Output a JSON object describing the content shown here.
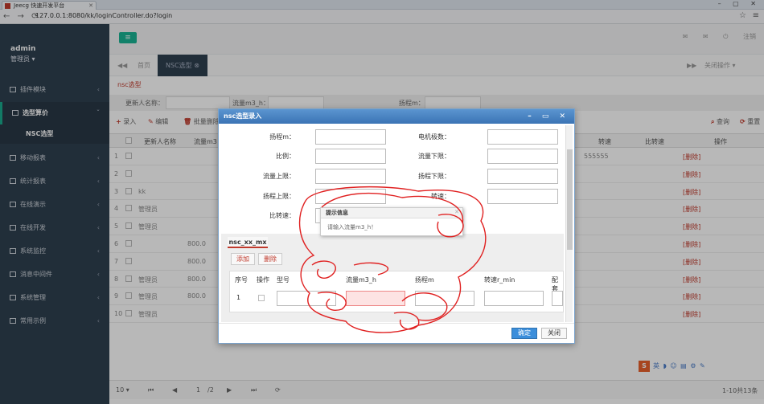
{
  "browser": {
    "tab_title": "Jeecg 快速开发平台",
    "url": "127.0.0.1:8080/kk/loginController.do?login"
  },
  "sidebar": {
    "user": "admin",
    "role": "管理员 ▾",
    "items": [
      {
        "label": "插件模块"
      },
      {
        "label": "选型算价"
      },
      {
        "label": "移动报表"
      },
      {
        "label": "统计报表"
      },
      {
        "label": "在线演示"
      },
      {
        "label": "在线开发"
      },
      {
        "label": "系统监控"
      },
      {
        "label": "消息中间件"
      },
      {
        "label": "系统管理"
      },
      {
        "label": "常用示例"
      }
    ],
    "sub_item": "NSC选型"
  },
  "header": {
    "exit_label": "注销"
  },
  "tabs": {
    "home": "首页",
    "current": "NSC选型",
    "close_ops": "关闭操作 ▾"
  },
  "main": {
    "breadcrumb": "nsc选型",
    "search": {
      "name_label": "更新人名称：",
      "flow_label": "流量m3_h：",
      "head_label": "扬程m："
    },
    "toolbar": {
      "add": "录入",
      "edit": "编辑",
      "batch_delete": "批量删除",
      "query": "查询",
      "reset": "重置"
    },
    "columns": [
      "更新人名称",
      "流量m3",
      "转速",
      "比转速",
      "操作"
    ],
    "rows": [
      {
        "no": "1",
        "name": "",
        "flow": "",
        "speed": "555555",
        "op": "[删除]"
      },
      {
        "no": "2",
        "name": "",
        "flow": "",
        "speed": "",
        "op": "[删除]"
      },
      {
        "no": "3",
        "name": "kk",
        "flow": "",
        "speed": "",
        "op": "[删除]"
      },
      {
        "no": "4",
        "name": "管理员",
        "flow": "",
        "speed": "",
        "op": "[删除]"
      },
      {
        "no": "5",
        "name": "管理员",
        "flow": "",
        "speed": "",
        "op": "[删除]"
      },
      {
        "no": "6",
        "name": "",
        "flow": "800.0",
        "speed": "",
        "op": "[删除]"
      },
      {
        "no": "7",
        "name": "",
        "flow": "800.0",
        "speed": "",
        "op": "[删除]"
      },
      {
        "no": "8",
        "name": "管理员",
        "flow": "800.0",
        "speed": "",
        "op": "[删除]"
      },
      {
        "no": "9",
        "name": "管理员",
        "flow": "800.0",
        "speed": "",
        "op": "[删除]"
      },
      {
        "no": "10",
        "name": "管理员",
        "flow": "",
        "speed": "",
        "op": "[删除]"
      }
    ],
    "pager": {
      "page_size": "10 ▾",
      "page_input": "1",
      "page_total": "/2",
      "range": "1-10共13条"
    }
  },
  "dialog": {
    "title": "nsc选型录入",
    "fields": {
      "head": "扬程m：",
      "motor_poles": "电机极数：",
      "ratio": "比例：",
      "flow_lower": "流量下限：",
      "flow_upper": "流量上限：",
      "head_lower": "扬程下限：",
      "head_upper": "扬程上限：",
      "speed": "转速：",
      "specific_speed": "比转速："
    },
    "sub_tab": "nsc_xx_mx",
    "sub_add": "添加",
    "sub_delete": "删除",
    "sub_columns": [
      "序号",
      "操作",
      "型号",
      "流量m3_h",
      "扬程m",
      "转速r_min",
      "配套功"
    ],
    "sub_row_no": "1",
    "ok": "确定",
    "close": "关闭"
  },
  "tip": {
    "title": "提示信息",
    "message": "请输入流量m3_h！"
  },
  "accent_colors": {
    "sidebar": "#2f4050",
    "primary": "#1ab394",
    "danger": "#c0392b",
    "dialog_title": "#3b74b5"
  }
}
